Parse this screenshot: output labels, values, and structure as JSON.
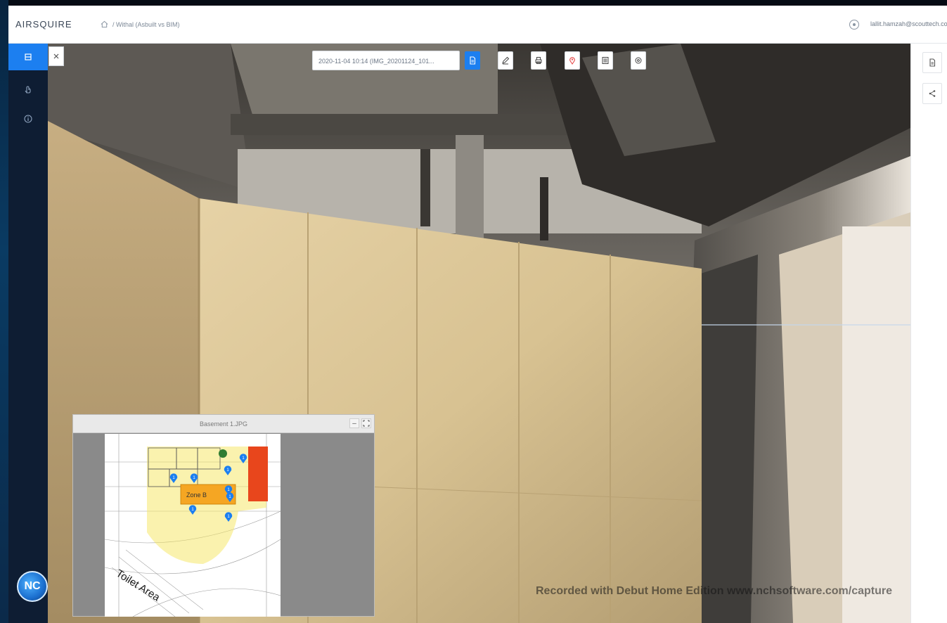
{
  "app": {
    "logo": "AIRSQUIRE"
  },
  "header": {
    "breadcrumb": "/ Withal (Asbuilt vs BIM)",
    "user": "lallit.hamzah@scouttech.com"
  },
  "toolbar": {
    "scan_selector_value": "2020-11-04 10:14 (IMG_20201124_101...",
    "tools": [
      {
        "name": "document-icon",
        "active": true
      },
      {
        "name": "edit-icon",
        "active": false
      },
      {
        "name": "print-icon",
        "active": false
      },
      {
        "name": "pin-icon",
        "active": false
      },
      {
        "name": "list-icon",
        "active": false
      },
      {
        "name": "settings-icon",
        "active": false
      }
    ]
  },
  "sidebar": {
    "items": [
      {
        "name": "layers-icon",
        "active": true
      },
      {
        "name": "hand-icon",
        "active": false
      },
      {
        "name": "info-icon",
        "active": false
      }
    ]
  },
  "minimap": {
    "title": "Basement 1.JPG",
    "zone_label": "Zone B",
    "area_label": "Toilet Area",
    "pins": [
      "1",
      "1",
      "1",
      "1",
      "1",
      "1",
      "1",
      "1"
    ]
  },
  "watermark": "Recorded with Debut Home Edition www.nchsoftware.com/capture",
  "colors": {
    "accent": "#1c7ff0",
    "rail": "#0e1d33",
    "zone_highlight": "#f6e76b",
    "zone_orange": "#f5a623",
    "zone_red": "#e8461c"
  }
}
